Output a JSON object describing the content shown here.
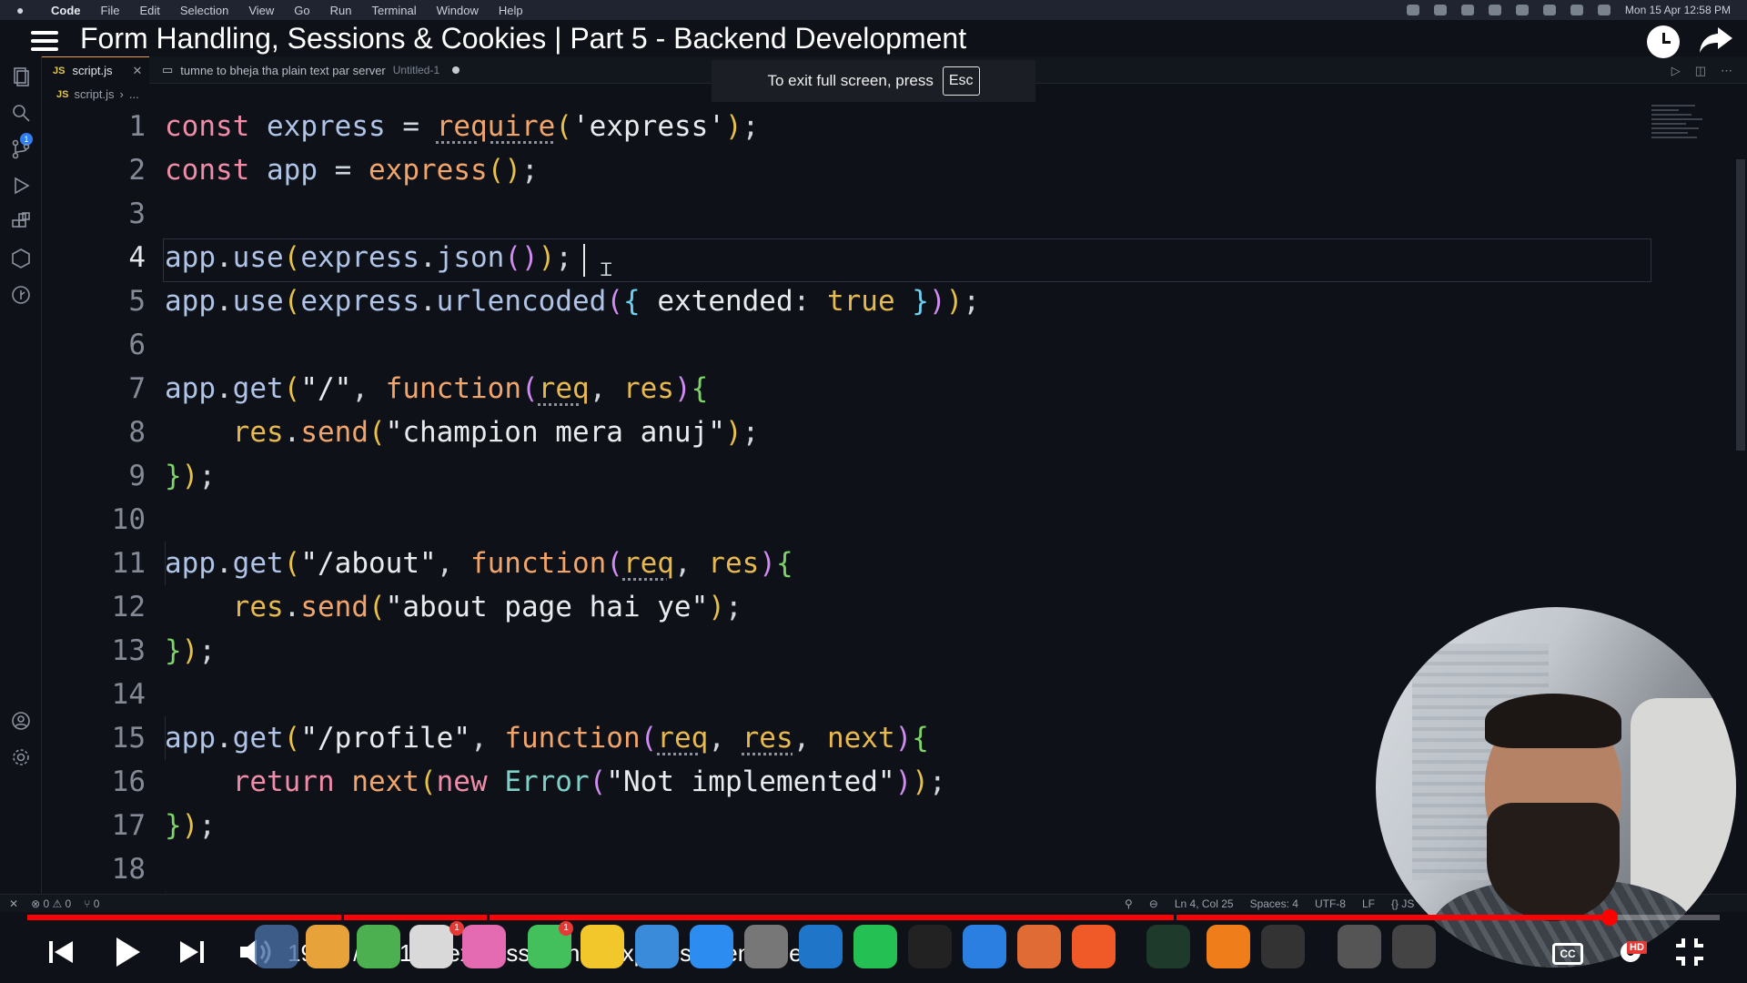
{
  "menubar": {
    "app": "Code",
    "items": [
      "File",
      "Edit",
      "Selection",
      "View",
      "Go",
      "Run",
      "Terminal",
      "Window",
      "Help"
    ],
    "datetime": "Mon 15 Apr  12:58 PM"
  },
  "video": {
    "title": "Form Handling, Sessions & Cookies | Part 5 - Backend Development",
    "time": "19:02 / 20:15",
    "chapter": "express.json & express.urlencoded",
    "progress": 0.935
  },
  "toast": {
    "text": "To exit full screen, press",
    "key": "Esc"
  },
  "tabs": [
    {
      "icon": "JS",
      "label": "script.js"
    },
    {
      "label": "tumne to bheja tha plain text par server",
      "sub": "Untitled-1"
    }
  ],
  "breadcrumb": {
    "file": "script.js",
    "rest": "..."
  },
  "editor": {
    "current_line": 4,
    "line_numbers": [
      "1",
      "2",
      "3",
      "4",
      "5",
      "6",
      "7",
      "8",
      "9",
      "10",
      "11",
      "12",
      "13",
      "14",
      "15",
      "16",
      "17",
      "18"
    ]
  },
  "activity": {
    "badge": "1"
  },
  "statusbar": {
    "problems": "⊗ 0 ⚠ 0",
    "ports": "⑂ 0",
    "position": "Ln 4, Col 25",
    "spaces": "Spaces: 4",
    "encoding": "UTF-8",
    "eol": "LF",
    "lang": "{} JS"
  },
  "dock": {
    "badges": [
      "1",
      "1"
    ]
  },
  "player": {
    "cc": "CC",
    "hd": "HD"
  }
}
